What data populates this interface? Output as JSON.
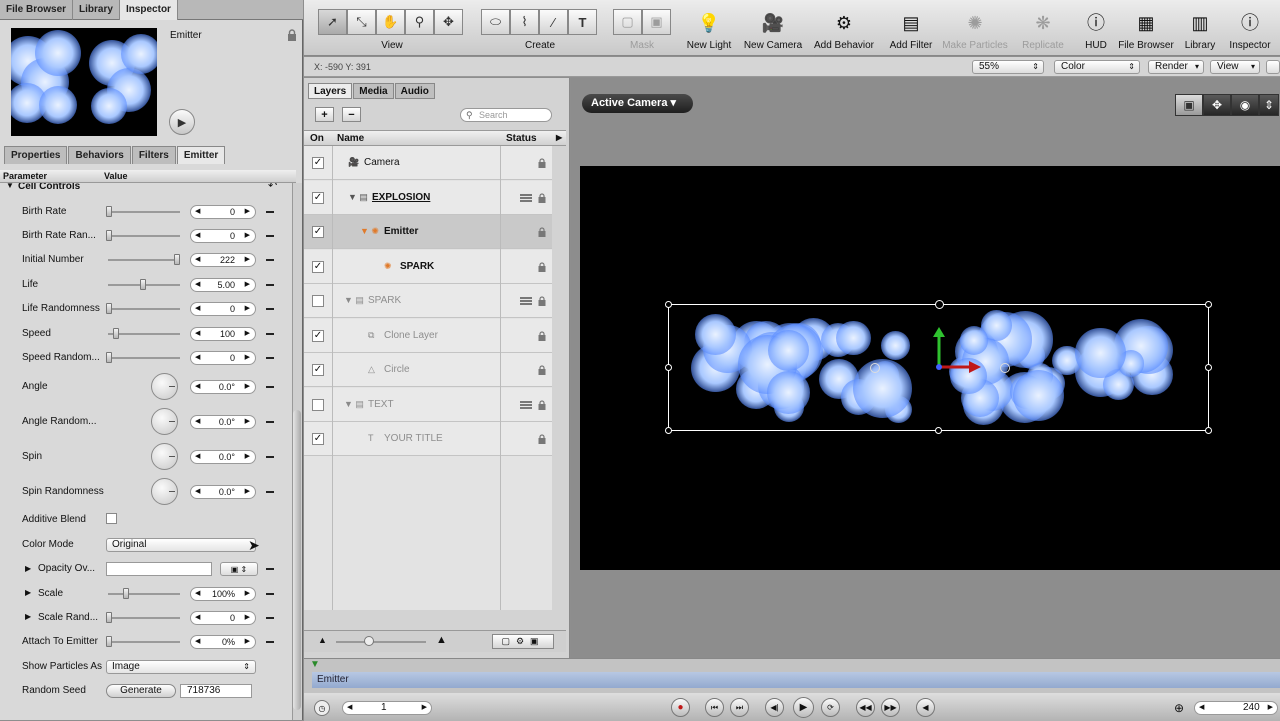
{
  "top_tabs": [
    "File Browser",
    "Library",
    "Inspector"
  ],
  "inspector": {
    "object_name": "Emitter",
    "sub_tabs": [
      "Properties",
      "Behaviors",
      "Filters",
      "Emitter"
    ],
    "col_parameter": "Parameter",
    "col_value": "Value",
    "section": "Cell Controls",
    "params": {
      "birth_rate": {
        "label": "Birth Rate",
        "value": "0"
      },
      "birth_rate_rand": {
        "label": "Birth Rate Ran...",
        "value": "0"
      },
      "initial_number": {
        "label": "Initial Number",
        "value": "222"
      },
      "life": {
        "label": "Life",
        "value": "5.00"
      },
      "life_rand": {
        "label": "Life Randomness",
        "value": "0"
      },
      "speed": {
        "label": "Speed",
        "value": "100"
      },
      "speed_rand": {
        "label": "Speed Random...",
        "value": "0"
      },
      "angle": {
        "label": "Angle",
        "value": "0.0°"
      },
      "angle_rand": {
        "label": "Angle Random...",
        "value": "0.0°"
      },
      "spin": {
        "label": "Spin",
        "value": "0.0°"
      },
      "spin_rand": {
        "label": "Spin Randomness",
        "value": "0.0°"
      },
      "additive_blend": {
        "label": "Additive Blend",
        "checked": false
      },
      "color_mode": {
        "label": "Color Mode",
        "value": "Original"
      },
      "opacity": {
        "label": "Opacity Ov..."
      },
      "scale": {
        "label": "Scale",
        "value": "100%"
      },
      "scale_rand": {
        "label": "Scale Rand...",
        "value": "0"
      },
      "attach": {
        "label": "Attach To Emitter",
        "value": "0%"
      },
      "show_as": {
        "label": "Show Particles As",
        "value": "Image"
      },
      "seed": {
        "label": "Random Seed",
        "button": "Generate",
        "value": "718736"
      }
    }
  },
  "toolbar": {
    "view_label": "View",
    "create_label": "Create",
    "mask_label": "Mask",
    "tools": [
      {
        "label": "New Light",
        "icon": "bulb-icon",
        "enabled": true
      },
      {
        "label": "New Camera",
        "icon": "camera-icon",
        "enabled": true
      },
      {
        "label": "Add Behavior",
        "icon": "gear-icon",
        "enabled": true
      },
      {
        "label": "Add Filter",
        "icon": "filter-icon",
        "enabled": true
      },
      {
        "label": "Make Particles",
        "icon": "particles-icon",
        "enabled": false
      },
      {
        "label": "Replicate",
        "icon": "replicate-icon",
        "enabled": false
      },
      {
        "label": "HUD",
        "icon": "info-icon",
        "enabled": true
      },
      {
        "label": "File Browser",
        "icon": "file-browser-icon",
        "enabled": true
      },
      {
        "label": "Library",
        "icon": "library-icon",
        "enabled": true
      },
      {
        "label": "Inspector",
        "icon": "inspector-icon",
        "enabled": true
      }
    ]
  },
  "statusbar": {
    "coords": "X: -590    Y: 391",
    "zoom": "55%",
    "channels": "Color",
    "render": "Render",
    "view": "View"
  },
  "layers_panel": {
    "tabs": [
      "Layers",
      "Media",
      "Audio"
    ],
    "search_placeholder": "Search",
    "col_on": "On",
    "col_name": "Name",
    "col_status": "Status",
    "rows": [
      {
        "name": "Camera",
        "on": true
      },
      {
        "name": "EXPLOSION",
        "on": true
      },
      {
        "name": "Emitter",
        "on": true
      },
      {
        "name": "SPARK",
        "on": true
      },
      {
        "name": "SPARK",
        "on": false
      },
      {
        "name": "Clone Layer",
        "on": true
      },
      {
        "name": "Circle",
        "on": true
      },
      {
        "name": "TEXT",
        "on": false
      },
      {
        "name": "YOUR TITLE",
        "on": true
      }
    ]
  },
  "canvas": {
    "camera_button": "Active Camera ▾"
  },
  "timeline": {
    "track_name": "Emitter",
    "current_frame": "1",
    "end_frame": "240"
  },
  "colors": {
    "accent_green": "#2fc22f",
    "accent_red": "#c01818",
    "particle_blue": "#9fc0ff"
  }
}
